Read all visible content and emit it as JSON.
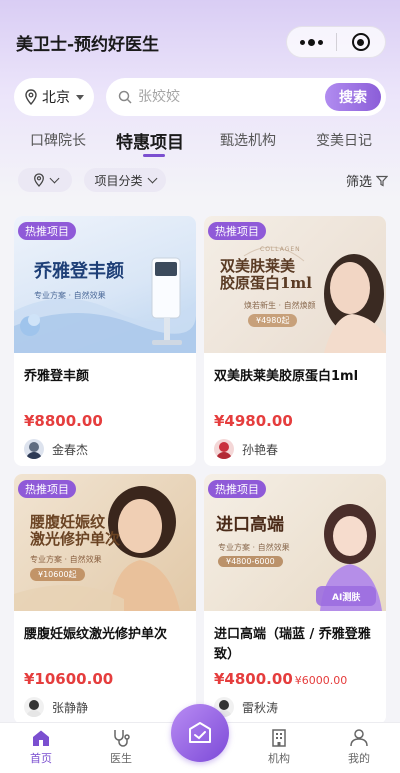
{
  "app": {
    "title": "美卫士-预约好医生"
  },
  "search": {
    "city": "北京",
    "placeholder": "张姣姣",
    "button_label": "搜索"
  },
  "tabs": [
    {
      "label": "口碑院长"
    },
    {
      "label": "特惠项目"
    },
    {
      "label": "甄选机构"
    },
    {
      "label": "变美日记"
    }
  ],
  "filters": {
    "category_label": "项目分类",
    "screen_label": "筛选"
  },
  "products": [
    {
      "tag": "热推项目",
      "name": "乔雅登丰颜",
      "price": "¥8800.00",
      "original_price": "",
      "doctor": "金春杰",
      "image_text": {
        "headline": "乔雅登丰颜",
        "sub": "专业方案 · 自然效果"
      }
    },
    {
      "tag": "热推项目",
      "name": "双美肤莱美胶原蛋白1ml",
      "price": "¥4980.00",
      "original_price": "",
      "doctor": "孙艳春",
      "image_text": {
        "headline_1": "双美肤莱美",
        "headline_2": "胶原蛋白1ml",
        "sub": "焕若新生 · 自然焕颜",
        "price_chip": "¥4980起",
        "brand": "COLLAGEN"
      }
    },
    {
      "tag": "热推项目",
      "name": "腰腹妊娠纹激光修护单次",
      "price": "¥10600.00",
      "original_price": "",
      "doctor": "张静静",
      "image_text": {
        "headline_1": "腰腹妊娠纹",
        "headline_2": "激光修护单次",
        "sub": "专业方案 · 自然效果",
        "price_chip": "¥10600起"
      }
    },
    {
      "tag": "热推项目",
      "name": "进口高端（瑞蓝 / 乔雅登雅致）",
      "price": "¥4800.00",
      "original_price": "¥6000.00",
      "doctor": "雷秋涛",
      "image_text": {
        "headline": "进口高端",
        "sub": "专业方案 · 自然效果",
        "price_chip": "¥4800-6000",
        "badge": "AI测肤"
      }
    }
  ],
  "tabbar": [
    {
      "label": "首页",
      "icon": "home-icon"
    },
    {
      "label": "医生",
      "icon": "stethoscope-icon"
    },
    {
      "label": "",
      "icon": "ai-diary-icon"
    },
    {
      "label": "机构",
      "icon": "building-icon"
    },
    {
      "label": "我的",
      "icon": "person-icon"
    }
  ],
  "colors": {
    "accent": "#7b4fd0",
    "price": "#e53d3d",
    "tag": "#8f5ad8"
  }
}
